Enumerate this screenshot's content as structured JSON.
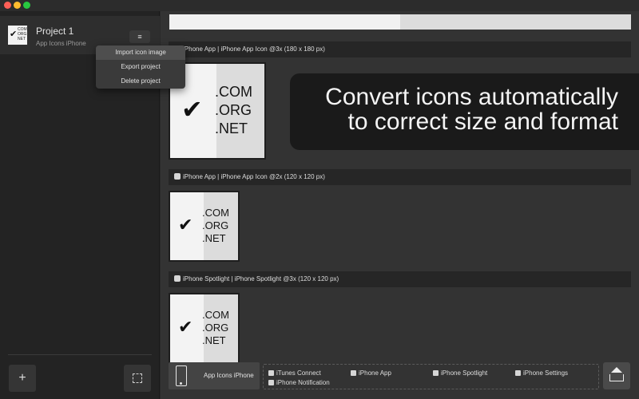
{
  "titlebar": {
    "buttons": [
      "close",
      "minimize",
      "zoom"
    ]
  },
  "sidebar": {
    "project": {
      "title": "Project 1",
      "subtitle": "App Icons iPhone",
      "menu_glyph": "≡",
      "thumb_check": "✔",
      "thumb_text": "COM ORG NET"
    },
    "menu": {
      "items": [
        "Import icon image",
        "Export project",
        "Delete project"
      ],
      "active_index": 0
    },
    "add_glyph": "+",
    "add_icon": "plus-icon",
    "select_icon": "dashed-square-icon"
  },
  "main": {
    "sections": [
      {
        "label": "iPhone App | iPhone App Icon @3x (180 x 180 px)",
        "checked": true
      },
      {
        "label": "iPhone App | iPhone App Icon @2x (120 x 120 px)",
        "checked": true
      },
      {
        "label": "iPhone Spotlight | iPhone Spotlight @3x (120 x 120 px)",
        "checked": true
      }
    ],
    "icon": {
      "check": "✔",
      "lines": [
        ".COM",
        ".ORG",
        ".NET"
      ]
    },
    "banner": {
      "line1": "Convert icons automatically",
      "line2": "to correct size and format"
    }
  },
  "footer": {
    "device_label": "App Icons iPhone",
    "device_icon": "iphone-icon",
    "checks": [
      "iTunes Connect",
      "iPhone App",
      "iPhone Spotlight",
      "iPhone Settings",
      "iPhone Notification"
    ],
    "upload_icon": "upload-tray-icon"
  },
  "colors": {
    "sidebar_bg": "#232323",
    "main_bg": "#333333",
    "menu_bg": "#3a3a3a",
    "menu_active": "#4e4e4e",
    "traffic_red": "#fe5f57",
    "traffic_yellow": "#febc2e",
    "traffic_green": "#28c840"
  }
}
